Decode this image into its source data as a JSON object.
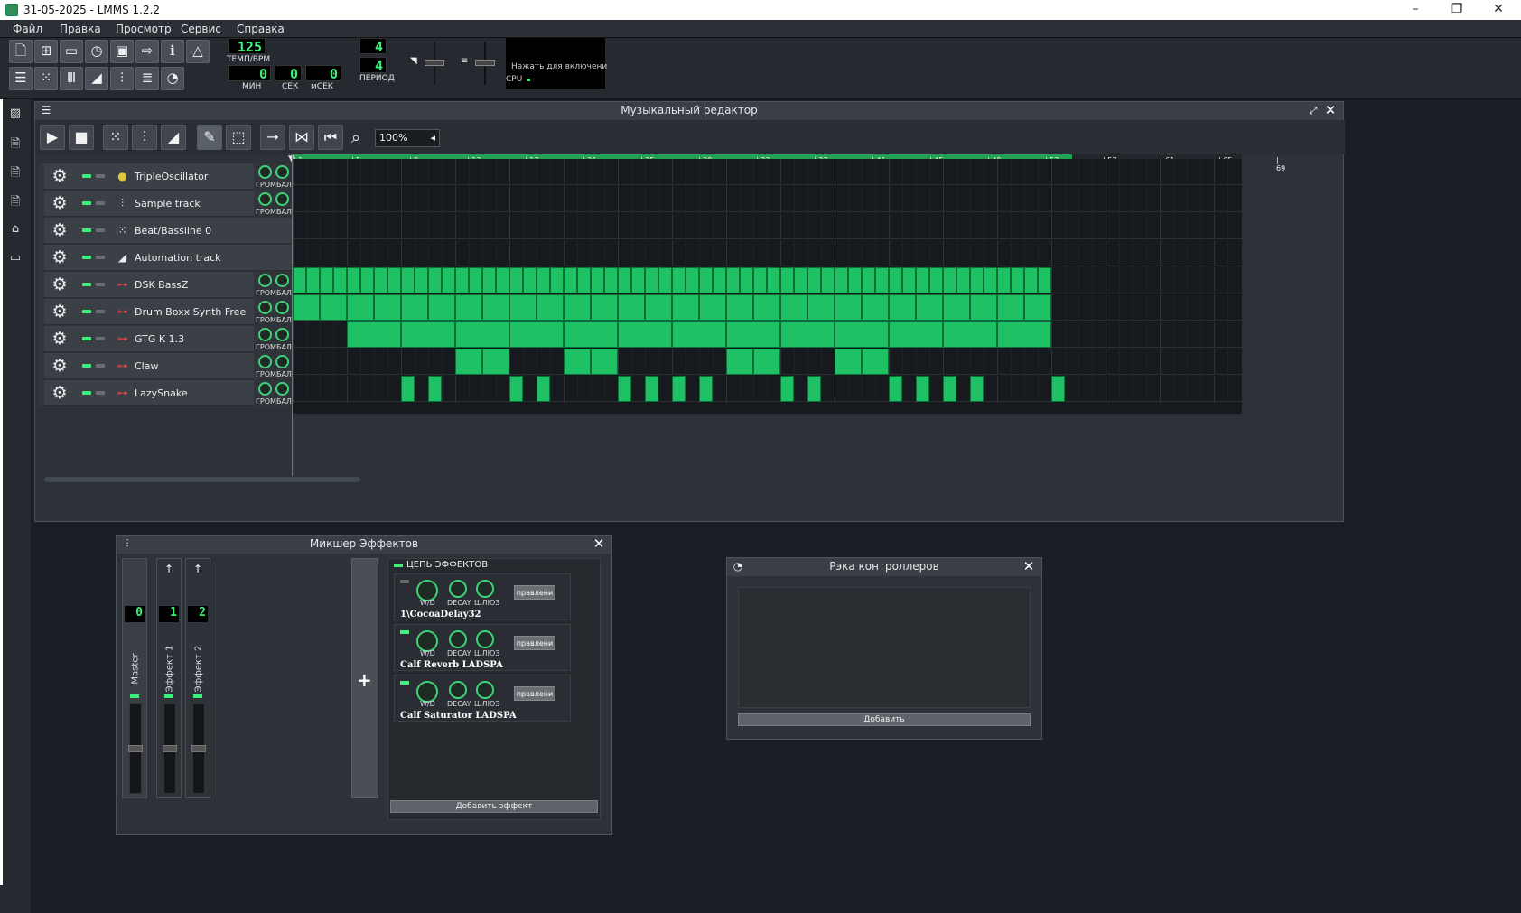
{
  "window": {
    "title": "31-05-2025 - LMMS 1.2.2"
  },
  "menu": [
    "Файл",
    "Правка",
    "Просмотр",
    "Сервис",
    "Справка"
  ],
  "toolbar": {
    "tempo_value": "125",
    "tempo_label": "ТЕМП/BPM",
    "min_value": "0",
    "min_label": "МИН",
    "sec_value": "0",
    "sec_label": "СЕК",
    "msec_value": "0",
    "msec_label": "мСЕК",
    "sig_num": "4",
    "sig_den": "4",
    "period_label": "ПЕРИОД",
    "cpu_hint": "Нажать для включени",
    "cpu_label": "CPU"
  },
  "song_editor": {
    "title": "Музыкальный редактор",
    "zoom": "100%",
    "bar_labels": [
      "1",
      "5",
      "9",
      "13",
      "17",
      "21",
      "25",
      "29",
      "33",
      "37",
      "41",
      "45",
      "49",
      "53",
      "57",
      "61",
      "65",
      "69"
    ],
    "knob_label": "ГРОМБАЛ",
    "tracks": [
      {
        "name": "TripleOscillator",
        "icon": "triple-oscillator-icon"
      },
      {
        "name": "Sample track",
        "icon": "waveform-icon"
      },
      {
        "name": "Beat/Bassline 0",
        "icon": "beat-grid-icon"
      },
      {
        "name": "Automation track",
        "icon": "automation-ramp-icon"
      },
      {
        "name": "DSK BassZ",
        "icon": "vst-plug-icon"
      },
      {
        "name": "Drum Boxx Synth Free",
        "icon": "vst-plug-icon"
      },
      {
        "name": "GTG K 1.3",
        "icon": "vst-plug-icon"
      },
      {
        "name": "Claw",
        "icon": "vst-plug-icon"
      },
      {
        "name": "LazySnake",
        "icon": "vst-plug-icon"
      }
    ]
  },
  "mixer": {
    "title": "Микшер Эффектов",
    "channels": [
      {
        "name": "Master",
        "number": "0"
      },
      {
        "name": "Эффект 1",
        "number": "1"
      },
      {
        "name": "Эффект 2",
        "number": "2"
      }
    ],
    "fx_chain_label": "ЦЕПЬ ЭФФЕКТОВ",
    "knob_labels": [
      "W/D",
      "DECAY",
      "ШЛЮЗ"
    ],
    "control_label": "правлени",
    "effects": [
      "1\\CocoaDelay32",
      "Calf Reverb LADSPA",
      "Calf Saturator LADSPA"
    ],
    "add_effect": "Добавить эффект"
  },
  "controller_rack": {
    "title": "Рэка контроллеров",
    "add": "Добавить"
  },
  "colors": {
    "accent": "#1ec265",
    "lcd": "#3ef07a",
    "background": "#1b1f25",
    "panel": "#2d3138"
  }
}
